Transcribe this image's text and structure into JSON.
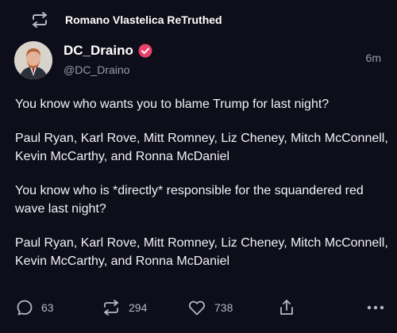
{
  "retruth": {
    "icon": "retruth-icon",
    "label": "Romano Vlastelica ReTruthed"
  },
  "post": {
    "author": {
      "display_name": "DC_Draino",
      "handle": "@DC_Draino",
      "verified_icon": "verified-badge-icon",
      "verified_color": "#e8436b",
      "avatar": "avatar"
    },
    "time": "6m",
    "paragraphs": [
      "You know who wants you to blame Trump for last night?",
      "Paul Ryan, Karl Rove, Mitt Romney, Liz Cheney, Mitch McConnell, Kevin McCarthy, and Ronna McDaniel",
      "You know who is *directly* responsible for the squandered red wave last night?",
      "Paul Ryan, Karl Rove, Mitt Romney, Liz Cheney, Mitch McConnell, Kevin McCarthy, and Ronna McDaniel"
    ]
  },
  "actions": {
    "reply": {
      "icon": "reply-icon",
      "count": "63"
    },
    "retruth": {
      "icon": "retruth-icon",
      "count": "294"
    },
    "like": {
      "icon": "heart-icon",
      "count": "738"
    },
    "share": {
      "icon": "share-icon"
    },
    "more": {
      "icon": "more-icon"
    }
  },
  "colors": {
    "background": "#0e0e1a",
    "text": "#ffffff",
    "muted": "#9a9aa8"
  }
}
